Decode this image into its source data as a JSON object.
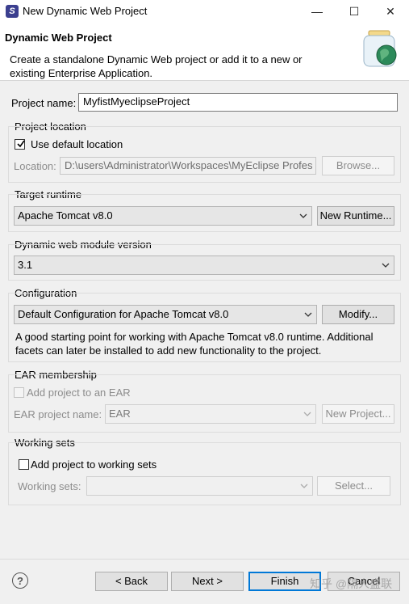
{
  "window": {
    "title": "New Dynamic Web Project",
    "icon": "eclipse-logo",
    "minimize_glyph": "—",
    "maximize_glyph": "☐",
    "close_glyph": "✕"
  },
  "banner": {
    "title": "Dynamic Web Project",
    "description": "Create a standalone Dynamic Web project or add it to a new or existing Enterprise Application."
  },
  "project_name": {
    "label": "Project name:",
    "value": "MyfistMyeclipseProject"
  },
  "project_location": {
    "group_label": "Project location",
    "use_default_label": "Use default location",
    "use_default_checked": true,
    "location_label": "Location:",
    "location_value": "D:\\users\\Administrator\\Workspaces\\MyEclipse Profes",
    "browse_label": "Browse..."
  },
  "target_runtime": {
    "group_label": "Target runtime",
    "selected": "Apache Tomcat v8.0",
    "new_runtime_label": "New Runtime..."
  },
  "module_version": {
    "group_label": "Dynamic web module version",
    "selected": "3.1"
  },
  "configuration": {
    "group_label": "Configuration",
    "selected": "Default Configuration for Apache Tomcat v8.0",
    "modify_label": "Modify...",
    "description": "A good starting point for working with Apache Tomcat v8.0 runtime. Additional facets can later be installed to add new functionality to the project."
  },
  "ear_membership": {
    "group_label": "EAR membership",
    "add_label": "Add project to an EAR",
    "add_checked": false,
    "ear_name_label": "EAR project name:",
    "ear_name_value": "EAR",
    "new_project_label": "New Project..."
  },
  "working_sets": {
    "group_label": "Working sets",
    "add_label": "Add project to working sets",
    "add_checked": false,
    "sets_label": "Working sets:",
    "sets_value": "",
    "select_label": "Select..."
  },
  "footer": {
    "help_glyph": "?",
    "back_label": "< Back",
    "next_label": "Next >",
    "finish_label": "Finish",
    "cancel_label": "Cancel",
    "watermark": "知乎 @隔人盛联"
  },
  "colors": {
    "dialog_bg": "#f0f0f0",
    "primary_border": "#0078d7",
    "disabled_text": "#8c8c8c"
  }
}
